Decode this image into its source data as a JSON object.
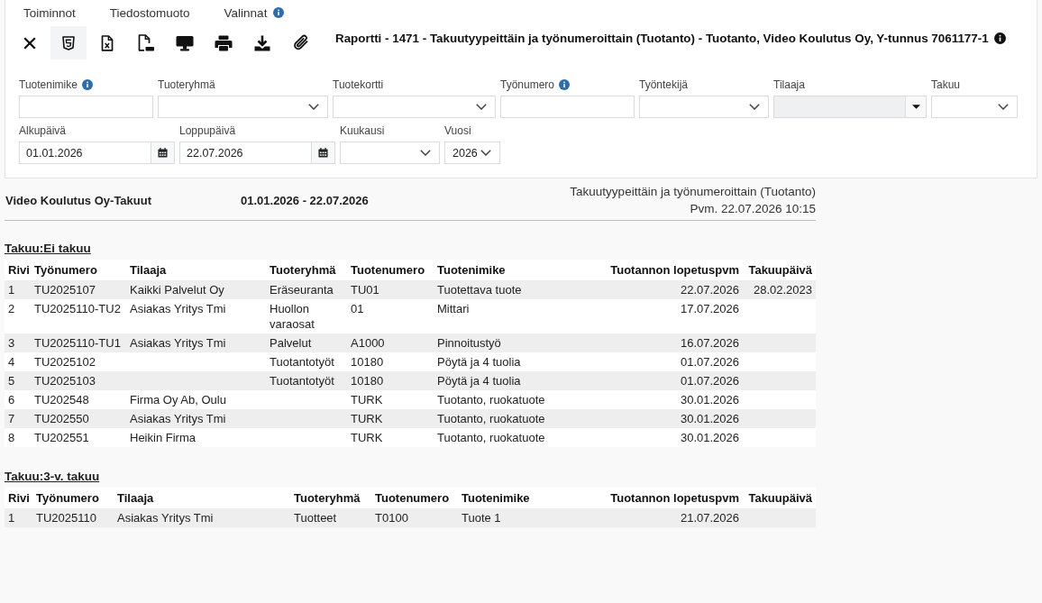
{
  "menu": [
    {
      "label": "Toiminnot",
      "info": false
    },
    {
      "label": "Tiedostomuoto",
      "info": false
    },
    {
      "label": "Valinnat",
      "info": true
    }
  ],
  "toolbar": {
    "buttons": [
      {
        "kind": "close",
        "selected": false
      },
      {
        "kind": "html",
        "selected": true
      },
      {
        "kind": "spreadsheet",
        "selected": false
      },
      {
        "kind": "pdf",
        "selected": false
      },
      {
        "kind": "screen",
        "selected": false
      },
      {
        "kind": "print",
        "selected": false
      },
      {
        "kind": "download",
        "selected": false
      },
      {
        "kind": "attach",
        "selected": false
      }
    ],
    "title": "Raportti - 1471 - Takuutyypeittäin ja työnumeroittain (Tuotanto) - Tuotanto, Video Koulutus Oy, Y-tunnus 7061177-1",
    "title_info": true
  },
  "filter_rows": [
    {
      "fields": [
        {
          "label": "Tuotenimike",
          "kind": "text",
          "info": true,
          "disabled": false
        },
        {
          "label": "Tuoteryhmä",
          "kind": "select",
          "info": false,
          "disabled": false
        },
        {
          "label": "Tuotekortti",
          "kind": "select",
          "info": false,
          "disabled": false
        },
        {
          "label": "Työnumero",
          "kind": "text",
          "info": true,
          "disabled": false
        },
        {
          "label": "Työntekijä",
          "kind": "select",
          "info": false,
          "disabled": false
        },
        {
          "label": "Tilaaja",
          "kind": "combo",
          "info": false,
          "disabled": true
        },
        {
          "label": "Takuu",
          "kind": "select",
          "info": false,
          "disabled": false
        }
      ]
    },
    {
      "fields": [
        {
          "label": "Alkupäivä",
          "kind": "date",
          "info": false,
          "disabled": false,
          "value": "01.01.2026"
        },
        {
          "label": "Loppupäivä",
          "kind": "date",
          "info": false,
          "disabled": false,
          "value": "22.07.2026"
        },
        {
          "label": "Kuukausi",
          "kind": "select",
          "info": false,
          "disabled": false
        },
        {
          "label": "Vuosi",
          "kind": "select",
          "info": false,
          "disabled": false,
          "value": "2026"
        }
      ]
    }
  ],
  "report": {
    "title": "Video Koulutus Oy-Takuut",
    "period": "01.01.2026 - 22.07.2026",
    "name": "Takuutyypeittäin ja työnumeroittain (Tuotanto)",
    "printed": "Pvm. 22.07.2026 10:15"
  },
  "sections": [
    {
      "heading": "Takuu:Ei takuu",
      "columns": {
        "row": "Rivi",
        "work_number": "Työnumero",
        "customer": "Tilaaja",
        "product_group": "Tuoteryhmä",
        "product_number": "Tuotenumero",
        "product_name": "Tuotenimike",
        "production_end_date": "Tuotannon lopetuspvm",
        "warranty_date": "Takuupäivä"
      },
      "rows": [
        {
          "row": "1",
          "work_number": "TU2025107",
          "customer": "Kaikki Palvelut Oy",
          "product_group": "Eräseuranta",
          "product_number": "TU01",
          "product_name": "Tuotettava tuote",
          "production_end_date": "22.07.2026",
          "warranty_date": "28.02.2023"
        },
        {
          "row": "2",
          "work_number": "TU2025110-TU2",
          "customer": "Asiakas Yritys Tmi",
          "product_group": "Huollon varaosat",
          "product_number": "01",
          "product_name": "Mittari",
          "production_end_date": "17.07.2026"
        },
        {
          "row": "3",
          "work_number": "TU2025110-TU1",
          "customer": "Asiakas Yritys Tmi",
          "product_group": "Palvelut",
          "product_number": "A1000",
          "product_name": "Pinnoitustyö",
          "production_end_date": "16.07.2026"
        },
        {
          "row": "4",
          "work_number": "TU2025102",
          "product_group": "Tuotantotyöt",
          "product_number": "10180",
          "product_name": "Pöytä ja 4 tuolia",
          "production_end_date": "01.07.2026"
        },
        {
          "row": "5",
          "work_number": "TU2025103",
          "product_group": "Tuotantotyöt",
          "product_number": "10180",
          "product_name": "Pöytä ja 4 tuolia",
          "production_end_date": "01.07.2026"
        },
        {
          "row": "6",
          "work_number": "TU202548",
          "customer": "Firma Oy Ab, Oulu",
          "product_number": "TURK",
          "product_name": "Tuotanto, ruokatuote",
          "production_end_date": "30.01.2026"
        },
        {
          "row": "7",
          "work_number": "TU202550",
          "customer": "Asiakas Yritys Tmi",
          "product_number": "TURK",
          "product_name": "Tuotanto, ruokatuote",
          "production_end_date": "30.01.2026"
        },
        {
          "row": "8",
          "work_number": "TU202551",
          "customer": "Heikin Firma",
          "product_number": "TURK",
          "product_name": "Tuotanto, ruokatuote",
          "production_end_date": "30.01.2026"
        }
      ]
    },
    {
      "heading": "Takuu:3-v. takuu",
      "columns": {
        "row": "Rivi",
        "work_number": "Työnumero",
        "customer": "Tilaaja",
        "product_group": "Tuoteryhmä",
        "product_number": "Tuotenumero",
        "product_name": "Tuotenimike",
        "production_end_date": "Tuotannon lopetuspvm",
        "warranty_date": "Takuupäivä"
      },
      "rows": [
        {
          "row": "1",
          "work_number": "TU2025110",
          "customer": "Asiakas Yritys Tmi",
          "product_group": "Tuotteet",
          "product_number": "T0100",
          "product_name": "Tuote 1",
          "production_end_date": "21.07.2026"
        }
      ]
    }
  ]
}
